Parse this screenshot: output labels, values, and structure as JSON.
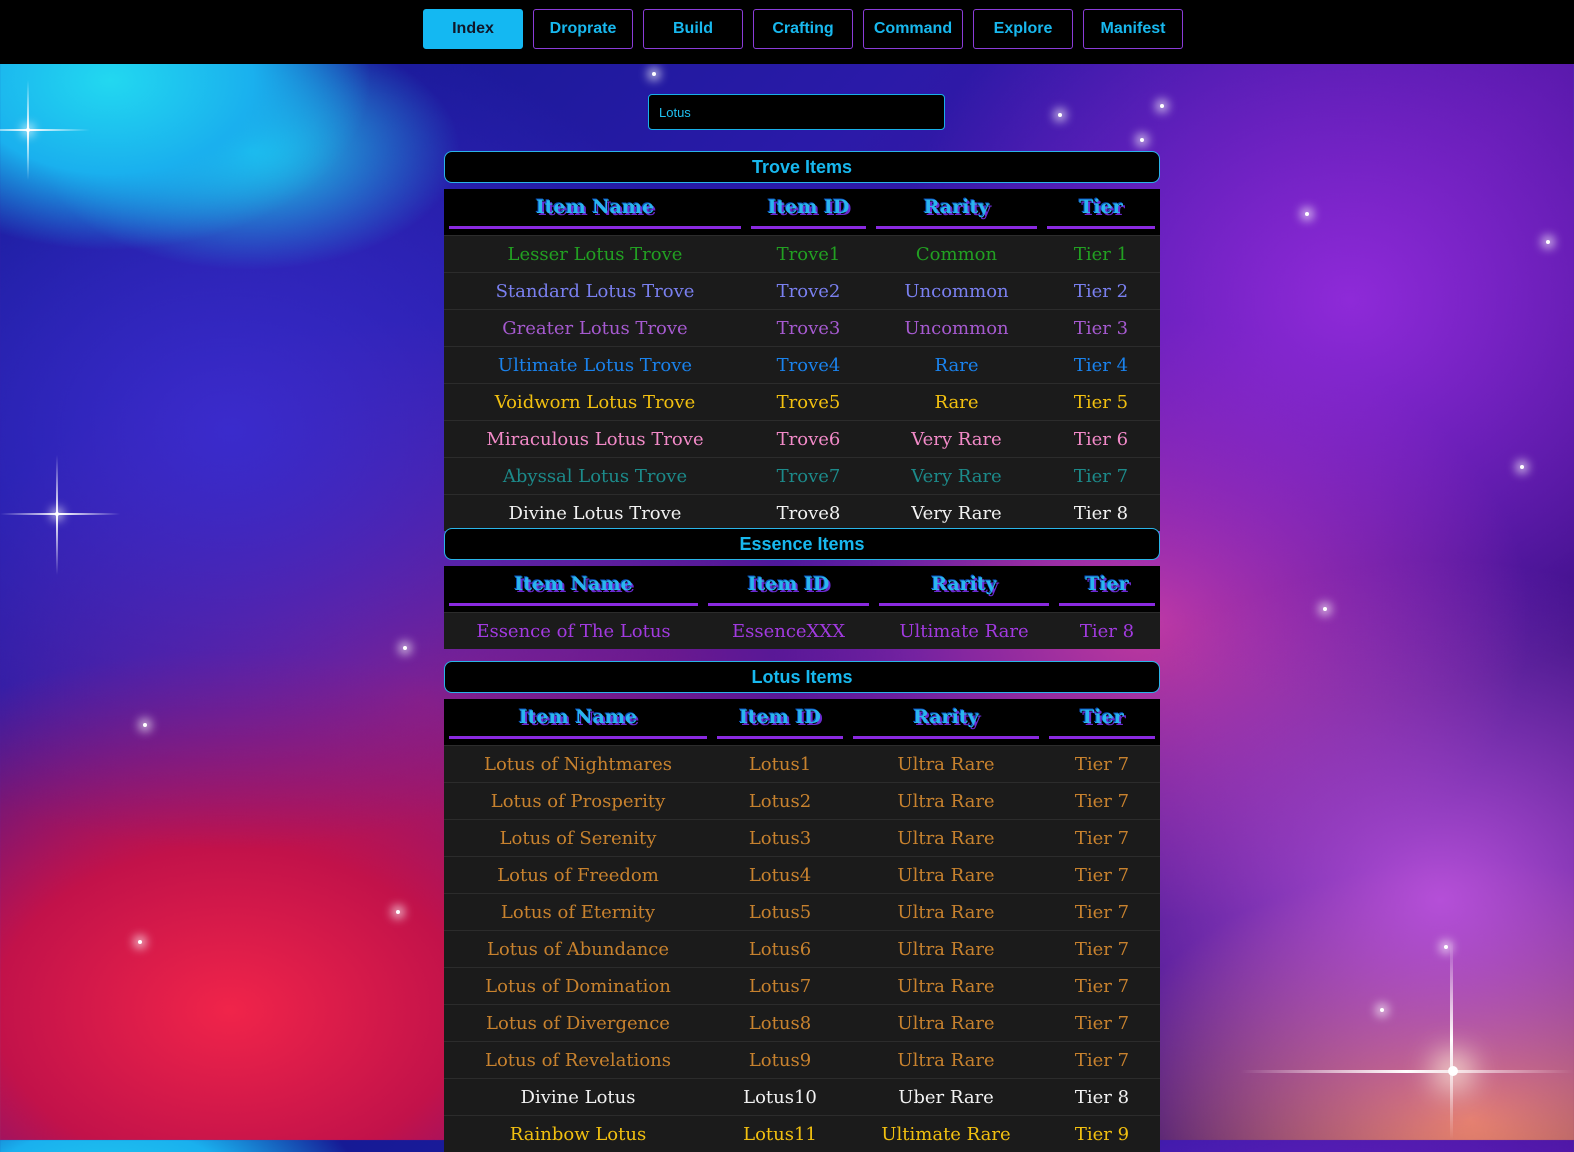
{
  "nav": {
    "items": [
      "Index",
      "Droprate",
      "Build",
      "Crafting",
      "Command",
      "Explore",
      "Manifest"
    ],
    "active": "Index"
  },
  "search": {
    "value": "Lotus"
  },
  "headers": [
    "Item Name",
    "Item ID",
    "Rarity",
    "Tier"
  ],
  "colors": {
    "accent": "#18b8ee",
    "border": "#8a2ae0",
    "common": "#22a022",
    "uncommon_blue": "#7a80f0",
    "uncommon_purple": "#a65ad0",
    "rare_blue": "#1a82ec",
    "rare_gold": "#f2c010",
    "very_rare_pink": "#f28ac8",
    "very_rare_teal": "#1c8a8a",
    "white": "#f2f2f2",
    "ultimate_purple": "#a23ae0",
    "ultra_orange": "#c8822e",
    "rainbow_gold": "#f2c010"
  },
  "sections": [
    {
      "title": "Trove Items",
      "rows": [
        {
          "name": "Lesser Lotus Trove",
          "id": "Trove1",
          "rarity": "Common",
          "tier": "Tier 1",
          "color": "#22a022"
        },
        {
          "name": "Standard Lotus Trove",
          "id": "Trove2",
          "rarity": "Uncommon",
          "tier": "Tier 2",
          "color": "#7a80f0"
        },
        {
          "name": "Greater Lotus Trove",
          "id": "Trove3",
          "rarity": "Uncommon",
          "tier": "Tier 3",
          "color": "#a65ad0"
        },
        {
          "name": "Ultimate Lotus Trove",
          "id": "Trove4",
          "rarity": "Rare",
          "tier": "Tier 4",
          "color": "#1a82ec"
        },
        {
          "name": "Voidworn Lotus Trove",
          "id": "Trove5",
          "rarity": "Rare",
          "tier": "Tier 5",
          "color": "#f2c010"
        },
        {
          "name": "Miraculous Lotus Trove",
          "id": "Trove6",
          "rarity": "Very Rare",
          "tier": "Tier 6",
          "color": "#f28ac8"
        },
        {
          "name": "Abyssal Lotus Trove",
          "id": "Trove7",
          "rarity": "Very Rare",
          "tier": "Tier 7",
          "color": "#1c8a8a"
        },
        {
          "name": "Divine Lotus Trove",
          "id": "Trove8",
          "rarity": "Very Rare",
          "tier": "Tier 8",
          "color": "#f2f2f2"
        }
      ]
    },
    {
      "title": "Essence Items",
      "rows": [
        {
          "name": "Essence of The Lotus",
          "id": "EssenceXXX",
          "rarity": "Ultimate Rare",
          "tier": "Tier 8",
          "color": "#a23ae0"
        }
      ]
    },
    {
      "title": "Lotus Items",
      "rows": [
        {
          "name": "Lotus of Nightmares",
          "id": "Lotus1",
          "rarity": "Ultra Rare",
          "tier": "Tier 7",
          "color": "#c8822e"
        },
        {
          "name": "Lotus of Prosperity",
          "id": "Lotus2",
          "rarity": "Ultra Rare",
          "tier": "Tier 7",
          "color": "#c8822e"
        },
        {
          "name": "Lotus of Serenity",
          "id": "Lotus3",
          "rarity": "Ultra Rare",
          "tier": "Tier 7",
          "color": "#c8822e"
        },
        {
          "name": "Lotus of Freedom",
          "id": "Lotus4",
          "rarity": "Ultra Rare",
          "tier": "Tier 7",
          "color": "#c8822e"
        },
        {
          "name": "Lotus of Eternity",
          "id": "Lotus5",
          "rarity": "Ultra Rare",
          "tier": "Tier 7",
          "color": "#c8822e"
        },
        {
          "name": "Lotus of Abundance",
          "id": "Lotus6",
          "rarity": "Ultra Rare",
          "tier": "Tier 7",
          "color": "#c8822e"
        },
        {
          "name": "Lotus of Domination",
          "id": "Lotus7",
          "rarity": "Ultra Rare",
          "tier": "Tier 7",
          "color": "#c8822e"
        },
        {
          "name": "Lotus of Divergence",
          "id": "Lotus8",
          "rarity": "Ultra Rare",
          "tier": "Tier 7",
          "color": "#c8822e"
        },
        {
          "name": "Lotus of Revelations",
          "id": "Lotus9",
          "rarity": "Ultra Rare",
          "tier": "Tier 7",
          "color": "#c8822e"
        },
        {
          "name": "Divine Lotus",
          "id": "Lotus10",
          "rarity": "Uber Rare",
          "tier": "Tier 8",
          "color": "#f2f2f2"
        },
        {
          "name": "Rainbow Lotus",
          "id": "Lotus11",
          "rarity": "Ultimate Rare",
          "tier": "Tier 9",
          "color": "#f2c010"
        }
      ]
    }
  ]
}
